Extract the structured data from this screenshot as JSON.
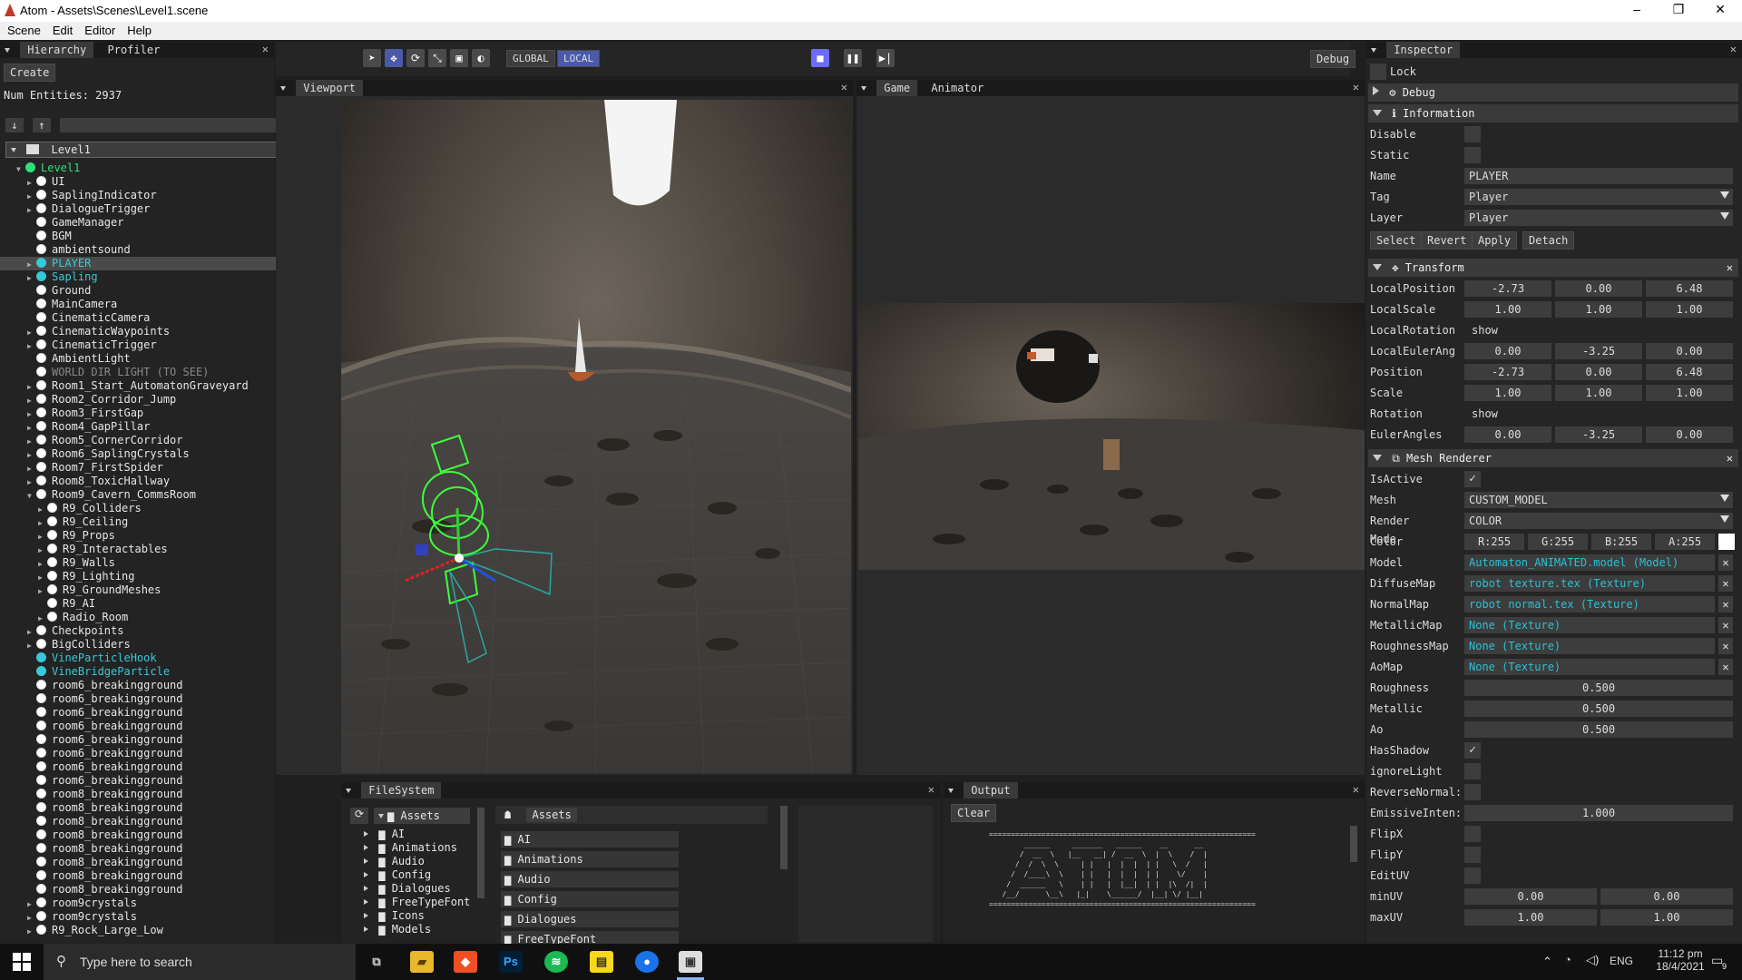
{
  "window": {
    "title": "Atom - Assets\\Scenes\\Level1.scene",
    "minimize": "–",
    "maximize": "❐",
    "close": "✕"
  },
  "menu": [
    "Scene",
    "Edit",
    "Editor",
    "Help"
  ],
  "hierarchy": {
    "tabs": [
      "Hierarchy",
      "Profiler"
    ],
    "create_label": "Create",
    "entities_label": "Num Entities: 2937",
    "root": "Level1",
    "items": [
      {
        "label": "Level1",
        "depth": 0,
        "exp": "open",
        "color": "green"
      },
      {
        "label": "UI",
        "depth": 1,
        "exp": "closed",
        "color": "white"
      },
      {
        "label": "SaplingIndicator",
        "depth": 1,
        "exp": "closed",
        "color": "white"
      },
      {
        "label": "DialogueTrigger",
        "depth": 1,
        "exp": "closed",
        "color": "white"
      },
      {
        "label": "GameManager",
        "depth": 1,
        "exp": "",
        "color": "white"
      },
      {
        "label": "BGM",
        "depth": 1,
        "exp": "",
        "color": "white"
      },
      {
        "label": "ambientsound",
        "depth": 1,
        "exp": "",
        "color": "white"
      },
      {
        "label": "PLAYER",
        "depth": 1,
        "exp": "closed",
        "color": "cyan",
        "selected": true
      },
      {
        "label": "Sapling",
        "depth": 1,
        "exp": "closed",
        "color": "cyan"
      },
      {
        "label": "Ground",
        "depth": 1,
        "exp": "",
        "color": "white"
      },
      {
        "label": "MainCamera",
        "depth": 1,
        "exp": "",
        "color": "white"
      },
      {
        "label": "CinematicCamera",
        "depth": 1,
        "exp": "",
        "color": "white"
      },
      {
        "label": "CinematicWaypoints",
        "depth": 1,
        "exp": "closed",
        "color": "white"
      },
      {
        "label": "CinematicTrigger",
        "depth": 1,
        "exp": "closed",
        "color": "white"
      },
      {
        "label": "AmbientLight",
        "depth": 1,
        "exp": "",
        "color": "white"
      },
      {
        "label": "WORLD DIR LIGHT (TO SEE)",
        "depth": 1,
        "exp": "",
        "color": "gray"
      },
      {
        "label": "Room1_Start_AutomatonGraveyard",
        "depth": 1,
        "exp": "closed",
        "color": "white"
      },
      {
        "label": "Room2_Corridor_Jump",
        "depth": 1,
        "exp": "closed",
        "color": "white"
      },
      {
        "label": "Room3_FirstGap",
        "depth": 1,
        "exp": "closed",
        "color": "white"
      },
      {
        "label": "Room4_GapPillar",
        "depth": 1,
        "exp": "closed",
        "color": "white"
      },
      {
        "label": "Room5_CornerCorridor",
        "depth": 1,
        "exp": "closed",
        "color": "white"
      },
      {
        "label": "Room6_SaplingCrystals",
        "depth": 1,
        "exp": "closed",
        "color": "white"
      },
      {
        "label": "Room7_FirstSpider",
        "depth": 1,
        "exp": "closed",
        "color": "white"
      },
      {
        "label": "Room8_ToxicHallway",
        "depth": 1,
        "exp": "closed",
        "color": "white"
      },
      {
        "label": "Room9_Cavern_CommsRoom",
        "depth": 1,
        "exp": "open",
        "color": "white"
      },
      {
        "label": "R9_Colliders",
        "depth": 2,
        "exp": "closed",
        "color": "white"
      },
      {
        "label": "R9_Ceiling",
        "depth": 2,
        "exp": "closed",
        "color": "white"
      },
      {
        "label": "R9_Props",
        "depth": 2,
        "exp": "closed",
        "color": "white"
      },
      {
        "label": "R9_Interactables",
        "depth": 2,
        "exp": "closed",
        "color": "white"
      },
      {
        "label": "R9_Walls",
        "depth": 2,
        "exp": "closed",
        "color": "white"
      },
      {
        "label": "R9_Lighting",
        "depth": 2,
        "exp": "closed",
        "color": "white"
      },
      {
        "label": "R9_GroundMeshes",
        "depth": 2,
        "exp": "closed",
        "color": "white"
      },
      {
        "label": "R9_AI",
        "depth": 2,
        "exp": "",
        "color": "white"
      },
      {
        "label": "Radio_Room",
        "depth": 2,
        "exp": "closed",
        "color": "white"
      },
      {
        "label": "Checkpoints",
        "depth": 1,
        "exp": "closed",
        "color": "white"
      },
      {
        "label": "BigColliders",
        "depth": 1,
        "exp": "closed",
        "color": "white"
      },
      {
        "label": "VineParticleHook",
        "depth": 1,
        "exp": "",
        "color": "cyan"
      },
      {
        "label": "VineBridgeParticle",
        "depth": 1,
        "exp": "",
        "color": "cyan"
      },
      {
        "label": "room6_breakingground",
        "depth": 1,
        "exp": "",
        "color": "white"
      },
      {
        "label": "room6_breakingground",
        "depth": 1,
        "exp": "",
        "color": "white"
      },
      {
        "label": "room6_breakingground",
        "depth": 1,
        "exp": "",
        "color": "white"
      },
      {
        "label": "room6_breakingground",
        "depth": 1,
        "exp": "",
        "color": "white"
      },
      {
        "label": "room6_breakingground",
        "depth": 1,
        "exp": "",
        "color": "white"
      },
      {
        "label": "room6_breakingground",
        "depth": 1,
        "exp": "",
        "color": "white"
      },
      {
        "label": "room6_breakingground",
        "depth": 1,
        "exp": "",
        "color": "white"
      },
      {
        "label": "room6_breakingground",
        "depth": 1,
        "exp": "",
        "color": "white"
      },
      {
        "label": "room8_breakingground",
        "depth": 1,
        "exp": "",
        "color": "white"
      },
      {
        "label": "room8_breakingground",
        "depth": 1,
        "exp": "",
        "color": "white"
      },
      {
        "label": "room8_breakingground",
        "depth": 1,
        "exp": "",
        "color": "white"
      },
      {
        "label": "room8_breakingground",
        "depth": 1,
        "exp": "",
        "color": "white"
      },
      {
        "label": "room8_breakingground",
        "depth": 1,
        "exp": "",
        "color": "white"
      },
      {
        "label": "room8_breakingground",
        "depth": 1,
        "exp": "",
        "color": "white"
      },
      {
        "label": "room8_breakingground",
        "depth": 1,
        "exp": "",
        "color": "white"
      },
      {
        "label": "room8_breakingground",
        "depth": 1,
        "exp": "",
        "color": "white"
      },
      {
        "label": "room9crystals",
        "depth": 1,
        "exp": "closed",
        "color": "white"
      },
      {
        "label": "room9crystals",
        "depth": 1,
        "exp": "closed",
        "color": "white"
      },
      {
        "label": "R9_Rock_Large_Low",
        "depth": 1,
        "exp": "closed",
        "color": "white"
      }
    ]
  },
  "toolbar": {
    "global_label": "GLOBAL",
    "local_label": "LOCAL",
    "debug_label": "Debug"
  },
  "viewport": {
    "tab": "Viewport"
  },
  "game": {
    "tabs": [
      "Game",
      "Animator"
    ]
  },
  "inspector": {
    "tab": "Inspector",
    "lock_label": "Lock",
    "debug_section": "Debug",
    "info_section": "Information",
    "disable_label": "Disable",
    "static_label": "Static",
    "name_label": "Name",
    "name_value": "PLAYER",
    "tag_label": "Tag",
    "tag_value": "Player",
    "layer_label": "Layer",
    "layer_value": "Player",
    "buttons": [
      "Select",
      "Revert",
      "Apply",
      "Detach"
    ],
    "transform_section": "Transform",
    "transform_rows": [
      {
        "label": "LocalPosition",
        "values": [
          "-2.73",
          "0.00",
          "6.48"
        ]
      },
      {
        "label": "LocalScale",
        "values": [
          "1.00",
          "1.00",
          "1.00"
        ]
      },
      {
        "label": "LocalRotation",
        "more": "show more"
      },
      {
        "label": "LocalEulerAng",
        "values": [
          "0.00",
          "-3.25",
          "0.00"
        ]
      },
      {
        "label": "Position",
        "values": [
          "-2.73",
          "0.00",
          "6.48"
        ]
      },
      {
        "label": "Scale",
        "values": [
          "1.00",
          "1.00",
          "1.00"
        ]
      },
      {
        "label": "Rotation",
        "more": "show more"
      },
      {
        "label": "EulerAngles",
        "values": [
          "0.00",
          "-3.25",
          "0.00"
        ]
      }
    ],
    "mesh_section": "Mesh Renderer",
    "isactive_label": "IsActive",
    "mesh_label": "Mesh",
    "mesh_value": "CUSTOM_MODEL",
    "render_mode_label": "Render Mode",
    "render_mode_value": "COLOR",
    "color_label": "Color",
    "color_values": [
      "R:255",
      "G:255",
      "B:255",
      "A:255"
    ],
    "asset_rows": [
      {
        "label": "Model",
        "value": "Automaton_ANIMATED.model (Model)"
      },
      {
        "label": "DiffuseMap",
        "value": "robot texture.tex (Texture)"
      },
      {
        "label": "NormalMap",
        "value": "robot normal.tex (Texture)"
      },
      {
        "label": "MetallicMap",
        "value": "None (Texture)"
      },
      {
        "label": "RoughnessMap",
        "value": "None (Texture)"
      },
      {
        "label": "AoMap",
        "value": "None (Texture)"
      }
    ],
    "scalar_rows": [
      {
        "label": "Roughness",
        "value": "0.500"
      },
      {
        "label": "Metallic",
        "value": "0.500"
      },
      {
        "label": "Ao",
        "value": "0.500"
      }
    ],
    "check_rows": [
      {
        "label": "HasShadow",
        "checked": true
      },
      {
        "label": "ignoreLight",
        "checked": false
      },
      {
        "label": "ReverseNormal:",
        "checked": false
      }
    ],
    "emissive_label": "EmissiveInten:",
    "emissive_value": "1.000",
    "check_rows2": [
      {
        "label": "FlipX",
        "checked": false
      },
      {
        "label": "FlipY",
        "checked": false
      },
      {
        "label": "EditUV",
        "checked": false
      }
    ],
    "minuv_label": "minUV",
    "minuv_values": [
      "0.00",
      "0.00"
    ],
    "maxuv_label": "maxUV",
    "maxuv_values": [
      "1.00",
      "1.00"
    ]
  },
  "filesystem": {
    "tab": "FileSystem",
    "root": "Assets",
    "tree": [
      "AI",
      "Animations",
      "Audio",
      "Config",
      "Dialogues",
      "FreeTypeFont",
      "Icons",
      "Models"
    ],
    "header": "Assets",
    "folders": [
      "AI",
      "Animations",
      "Audio",
      "Config",
      "Dialogues",
      "FreeTypeFont"
    ]
  },
  "output": {
    "tab": "Output",
    "clear_label": "Clear",
    "ascii": "=============================================================\n        ______     _______   ______    __      __\n       /  __  \\   |__   __| /  __  \\  |  \\    /  |\n      /  /  \\  \\     | |   |  |  |  | |   \\  /   |\n     /  /____\\  \\    | |   |  |  |  | |    \\/    |\n    /  ______   \\    | |   |  |__|  | |  |\\  /|  |\n   /__/      \\__\\   |_|    \\______/  |__| \\/ |__|\n============================================================="
  },
  "taskbar": {
    "search_placeholder": "Type here to search",
    "time": "11:12 pm",
    "date": "18/4/2021",
    "lang": "ENG",
    "notif_count": "9"
  }
}
